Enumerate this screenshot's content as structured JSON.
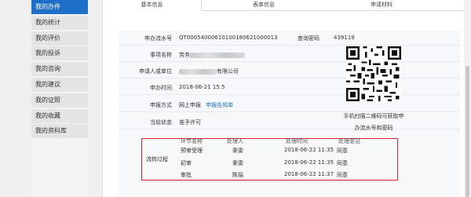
{
  "sidebar": {
    "items": [
      {
        "label": "我的办件",
        "active": true
      },
      {
        "label": "我的统计"
      },
      {
        "label": "我的评价"
      },
      {
        "label": "我的投诉"
      },
      {
        "label": "我的咨询"
      },
      {
        "label": "我的建议"
      },
      {
        "label": "我的证照"
      },
      {
        "label": "我的收藏"
      },
      {
        "label": "我的资料库"
      }
    ]
  },
  "tabs": [
    {
      "label": "基本信息",
      "active": true
    },
    {
      "label": "表单信息"
    },
    {
      "label": "申请材料"
    }
  ],
  "details": {
    "apply_no_label": "申办流水号",
    "apply_no": "QT00054000610100180621000013",
    "query_code_label": "查询密码",
    "query_code": "439119",
    "item_name_label": "事项名称",
    "item_name_prefix": "劳务",
    "applicant_label": "申请人或单位",
    "applicant_suffix": "有限公司",
    "apply_time_label": "申办时间",
    "apply_time": "2018-06-21 15:5",
    "apply_method_label": "申报方式",
    "apply_method": "网上申报",
    "apply_notice_link": "申报告知单",
    "status_label": "当前状态",
    "status": "准予许可"
  },
  "qr": {
    "caption_line1": "手机扫描二维码可获取申",
    "caption_line2": "办流水号和密码"
  },
  "flow": {
    "label": "流转过程",
    "headers": [
      "环节名称",
      "处理人",
      "处理时间",
      "处理意见"
    ],
    "rows": [
      {
        "step": "预审受理",
        "handler": "秦雯",
        "time": "2018-06-22 11:35",
        "opinion": "同意"
      },
      {
        "step": "初审",
        "handler": "秦雯",
        "time": "2018-06-22 11:35",
        "opinion": "同意"
      },
      {
        "step": "审批",
        "handler": "陈娟",
        "time": "2018-06-22 11:37",
        "opinion": "同意"
      }
    ]
  }
}
